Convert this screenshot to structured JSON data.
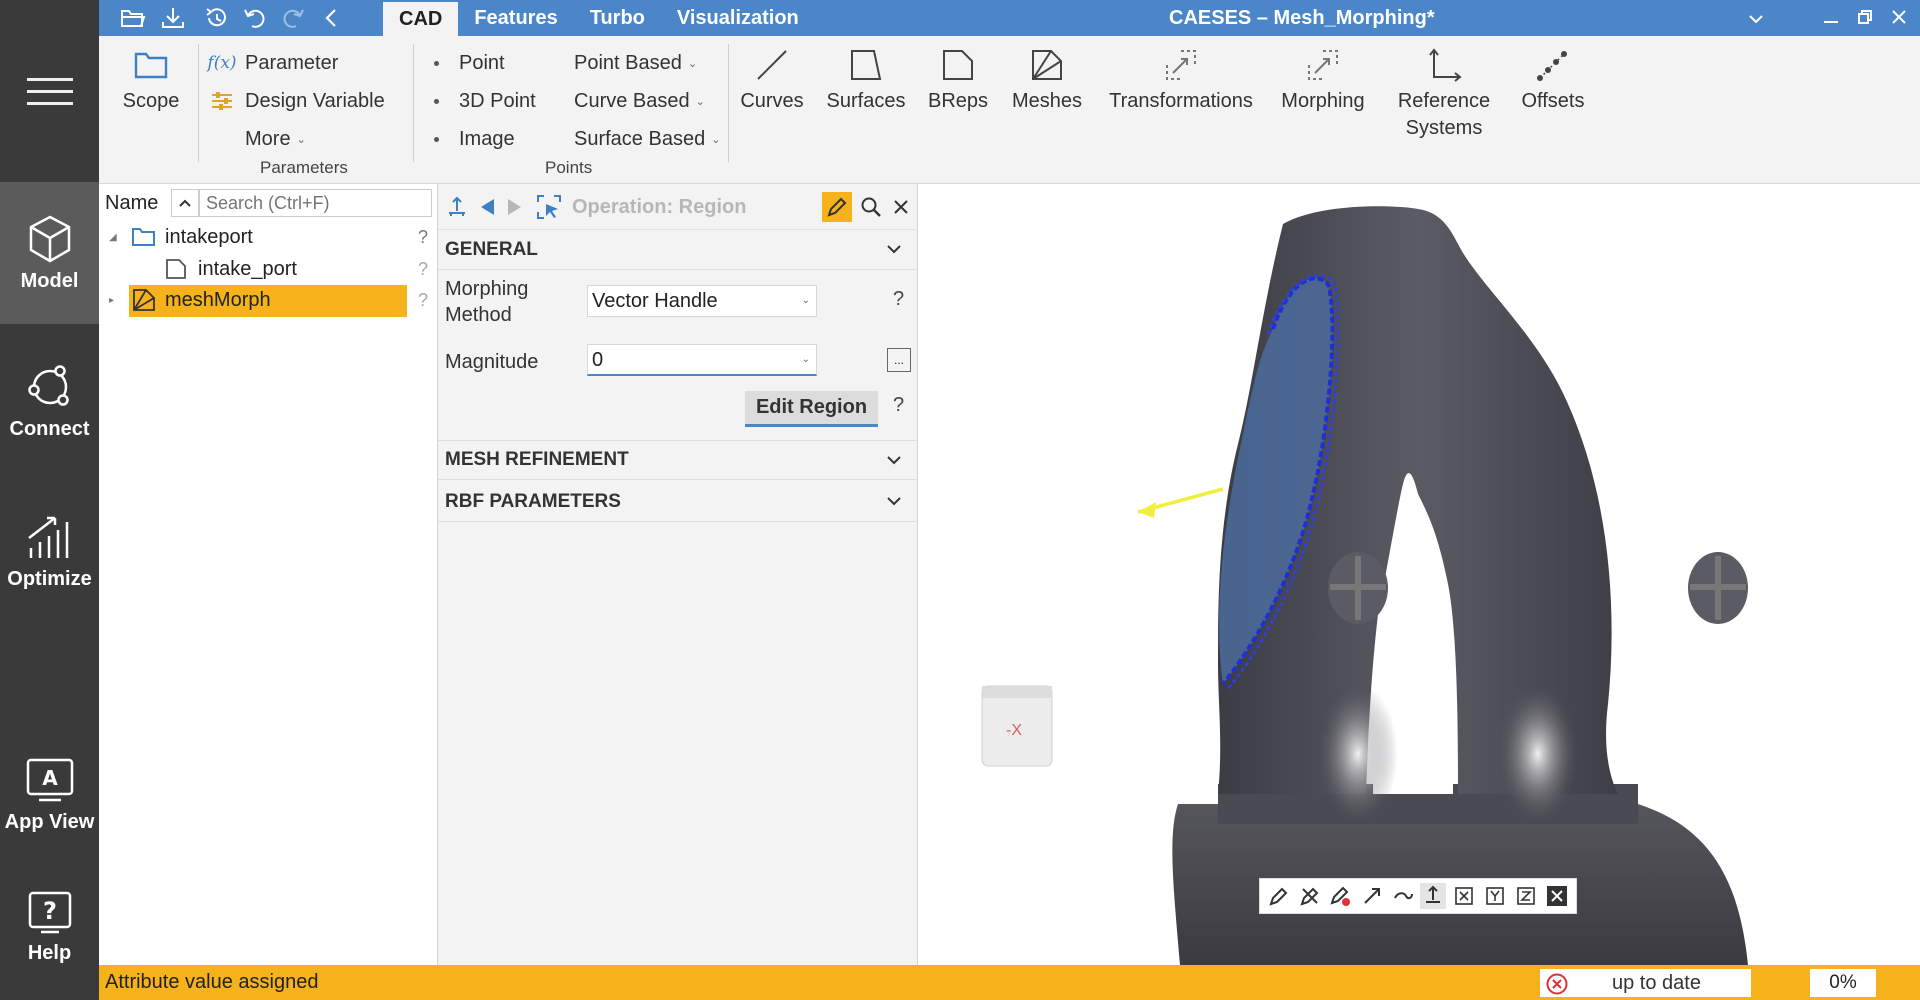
{
  "leftnav": {
    "items": [
      {
        "label": "Model",
        "active": true
      },
      {
        "label": "Connect",
        "active": false
      },
      {
        "label": "Optimize",
        "active": false
      },
      {
        "label": "App View",
        "active": false
      },
      {
        "label": "Help",
        "active": false
      }
    ]
  },
  "titlebar": {
    "tabs": [
      "CAD",
      "Features",
      "Turbo",
      "Visualization"
    ],
    "active_tab": "CAD",
    "window_title": "CAESES – Mesh_Morphing*"
  },
  "ribbon": {
    "scope": "Scope",
    "parameters": {
      "parameter": "Parameter",
      "design_variable": "Design Variable",
      "more": "More",
      "group": "Parameters",
      "fx": "f(x)"
    },
    "points": {
      "point": "Point",
      "point3d": "3D Point",
      "image": "Image",
      "point_based": "Point Based",
      "curve_based": "Curve Based",
      "surface_based": "Surface Based",
      "group": "Points"
    },
    "buttons": [
      "Curves",
      "Surfaces",
      "BReps",
      "Meshes",
      "Transformations",
      "Morphing"
    ],
    "reference_systems_1": "Reference",
    "reference_systems_2": "Systems",
    "offsets": "Offsets"
  },
  "tree": {
    "name_header": "Name",
    "search_placeholder": "Search (Ctrl+F)",
    "items": [
      {
        "label": "intakeport"
      },
      {
        "label": "intake_port"
      },
      {
        "label": "meshMorph"
      }
    ],
    "help": "?"
  },
  "props": {
    "operation_title": "Operation: Region",
    "sections": {
      "general": "GENERAL",
      "mesh_refinement": "MESH REFINEMENT",
      "rbf": "RBF PARAMETERS"
    },
    "morphing_method_label_1": "Morphing",
    "morphing_method_label_2": "Method",
    "morphing_method_value": "Vector Handle",
    "magnitude_label": "Magnitude",
    "magnitude_value": "0",
    "edit_region": "Edit Region",
    "help": "?",
    "ellipsis": "..."
  },
  "viewport": {
    "nav_cube_label": "-X"
  },
  "status": {
    "message": "Attribute value assigned",
    "state": "up to date",
    "progress": "0%"
  },
  "colors": {
    "accent": "#4a86c8",
    "highlight": "#f6b21b",
    "sidebar": "#3a3a3a"
  }
}
